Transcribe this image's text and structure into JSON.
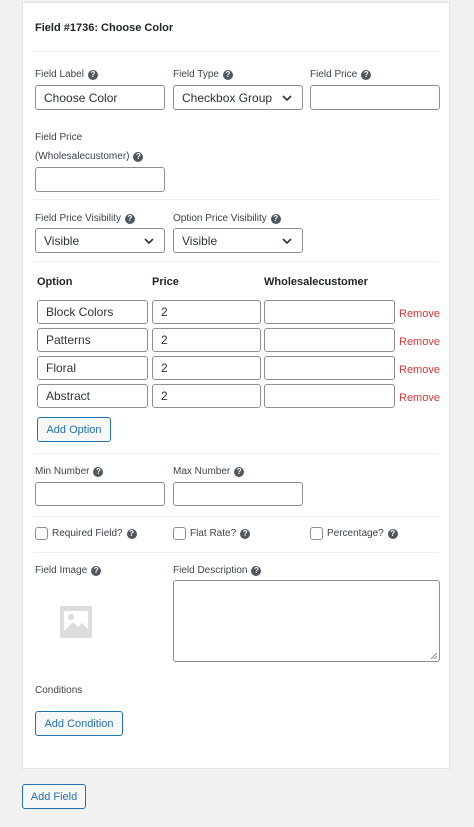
{
  "field": {
    "title": "Field #1736: Choose Color",
    "label_label": "Field Label",
    "label_value": "Choose Color",
    "type_label": "Field Type",
    "type_value": "Checkbox Group",
    "price_label": "Field Price",
    "price_value": "",
    "wholesale_price_label_line1": "Field Price",
    "wholesale_price_label_line2": "(Wholesalecustomer)",
    "wholesale_price_value": "",
    "price_visibility_label": "Field Price Visibility",
    "price_visibility_value": "Visible",
    "option_price_visibility_label": "Option Price Visibility",
    "option_price_visibility_value": "Visible"
  },
  "options_table": {
    "headers": [
      "Option",
      "Price",
      "Wholesalecustomer"
    ],
    "remove_label": "Remove",
    "rows": [
      {
        "option": "Block Colors",
        "price": "2",
        "wholesale": ""
      },
      {
        "option": "Patterns",
        "price": "2",
        "wholesale": ""
      },
      {
        "option": "Floral",
        "price": "2",
        "wholesale": ""
      },
      {
        "option": "Abstract",
        "price": "2",
        "wholesale": ""
      }
    ],
    "add_option_label": "Add Option"
  },
  "numbers": {
    "min_label": "Min Number",
    "min_value": "",
    "max_label": "Max Number",
    "max_value": ""
  },
  "checkboxes": {
    "required_label": "Required Field?",
    "flat_rate_label": "Flat Rate?",
    "percentage_label": "Percentage?"
  },
  "image": {
    "label": "Field Image",
    "placeholder_icon": "image-placeholder-icon"
  },
  "description": {
    "label": "Field Description",
    "value": ""
  },
  "conditions": {
    "label": "Conditions",
    "add_condition_label": "Add Condition"
  },
  "footer": {
    "add_field_label": "Add Field"
  },
  "icons": {
    "help": "?"
  },
  "colors": {
    "accent": "#2271b1",
    "remove": "#d63638"
  }
}
